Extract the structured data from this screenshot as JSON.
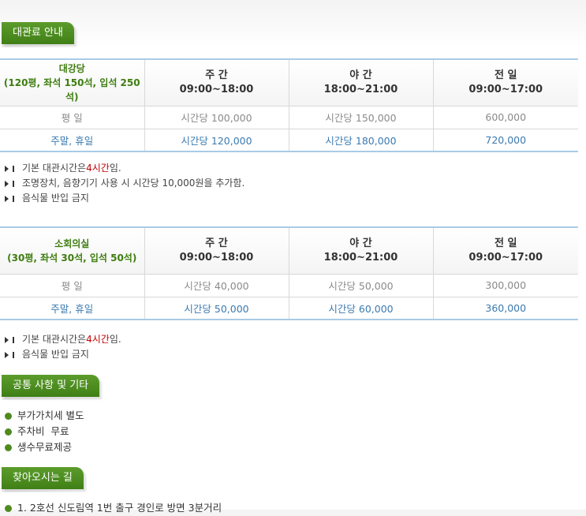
{
  "sections": {
    "fee_title": "대관료 안내",
    "common_title": "공통 사항 및 기타",
    "directions_title": "찾아오시는 길"
  },
  "table1": {
    "venue_name": "대강당",
    "venue_capacity": "(120평, 좌석 150석, 입석 250석)",
    "headers": [
      {
        "name": "주 간",
        "time": "09:00~18:00"
      },
      {
        "name": "야 간",
        "time": "18:00~21:00"
      },
      {
        "name": "전 일",
        "time": "09:00~17:00"
      }
    ],
    "rows": [
      {
        "label": "평 일",
        "values": [
          "시간당 100,000",
          "시간당 150,000",
          "600,000"
        ]
      },
      {
        "label": "주말, 휴일",
        "values": [
          "시간당 120,000",
          "시간당 180,000",
          "720,000"
        ]
      }
    ]
  },
  "notes1": {
    "n1_pre": "기본 대관시간은 ",
    "n1_red": "4시간",
    "n1_post": "임.",
    "n2": "조명장치, 음향기기 사용 시 시간당 10,000원을 추가함.",
    "n3": "음식물 반입 금지"
  },
  "table2": {
    "venue_name": "소회의실",
    "venue_capacity": "(30평, 좌석 30석, 입석 50석)",
    "headers": [
      {
        "name": "주 간",
        "time": "09:00~18:00"
      },
      {
        "name": "야 간",
        "time": "18:00~21:00"
      },
      {
        "name": "전 일",
        "time": "09:00~17:00"
      }
    ],
    "rows": [
      {
        "label": "평 일",
        "values": [
          "시간당 40,000",
          "시간당 50,000",
          "300,000"
        ]
      },
      {
        "label": "주말, 휴일",
        "values": [
          "시간당 50,000",
          "시간당 60,000",
          "360,000"
        ]
      }
    ]
  },
  "notes2": {
    "n1_pre": "기본 대관시간은 ",
    "n1_red": "4시간",
    "n1_post": "임.",
    "n2": "음식물 반입 금지"
  },
  "common": [
    "부가가치세 별도",
    "주차비  무료",
    "생수무료제공"
  ],
  "directions": [
    "1. 2호선 신도림역 1번 출구 경인로 방면 3분거리"
  ],
  "colors": {
    "green": "#3f7f16",
    "blue_text": "#3a7ab0",
    "red": "#c00000",
    "table_border": "#a9cbe6"
  }
}
